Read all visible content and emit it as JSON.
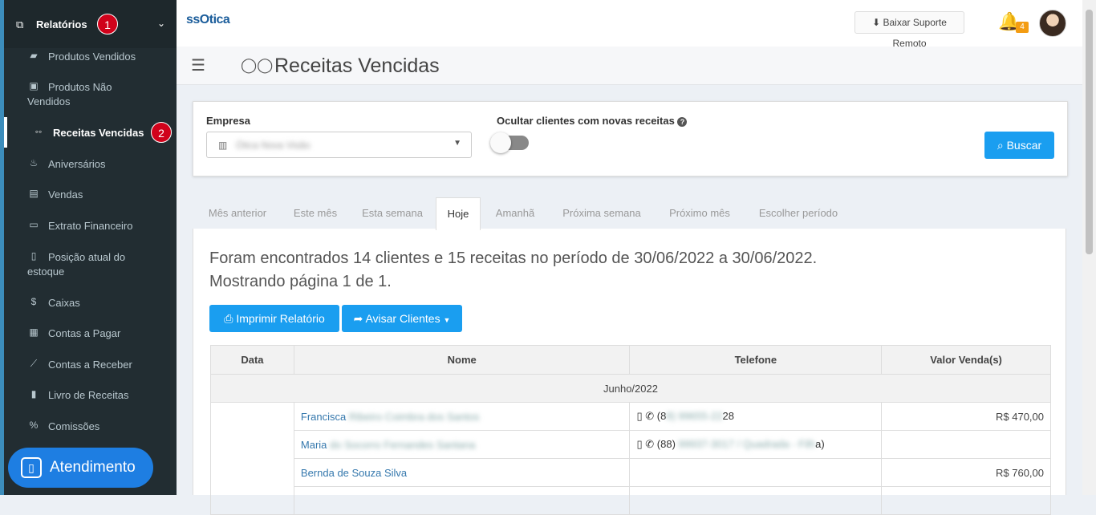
{
  "sidebar": {
    "header": {
      "label": "Relatórios",
      "badge": "1"
    },
    "items": [
      {
        "label": "Produtos Vendidos",
        "icon": "bag-icon",
        "glyph": "▰"
      },
      {
        "label": "Produtos Não Vendidos",
        "icon": "calendar-icon",
        "glyph": "▣"
      },
      {
        "label": "Receitas Vencidas",
        "icon": "glasses-icon",
        "glyph": "◦◦",
        "badge": "2"
      },
      {
        "label": "Aniversários",
        "icon": "cake-icon",
        "glyph": "♨"
      },
      {
        "label": "Vendas",
        "icon": "basket-icon",
        "glyph": "▤"
      },
      {
        "label": "Extrato Financeiro",
        "icon": "money-icon",
        "glyph": "▭"
      },
      {
        "label": "Posição atual do estoque",
        "icon": "file-icon",
        "glyph": "▯"
      },
      {
        "label": "Caixas",
        "icon": "dollar-icon",
        "glyph": "$"
      },
      {
        "label": "Contas a Pagar",
        "icon": "calculator-icon",
        "glyph": "▦"
      },
      {
        "label": "Contas a Receber",
        "icon": "chart-line-icon",
        "glyph": "⟋"
      },
      {
        "label": "Livro de Receitas",
        "icon": "book-icon",
        "glyph": "▮"
      },
      {
        "label": "Comissões",
        "icon": "percent-icon",
        "glyph": "%"
      }
    ],
    "atendimento": "Atendimento"
  },
  "topbar": {
    "logo": "ssOtica",
    "suporte": "⬇ Baixar Suporte Remoto",
    "notifications": "4"
  },
  "header": {
    "title": "Receitas Vencidas"
  },
  "filter": {
    "empresa_label": "Empresa",
    "empresa_value": "Ótica Nova Visão",
    "ocultar_label": "Ocultar clientes com novas receitas",
    "buscar": "Buscar"
  },
  "tabs": [
    "Mês anterior",
    "Este mês",
    "Esta semana",
    "Hoje",
    "Amanhã",
    "Próxima semana",
    "Próximo mês",
    "Escolher período"
  ],
  "summary": {
    "line1": "Foram encontrados 14 clientes e 15 receitas no período de 30/06/2022 a 30/06/2022.",
    "line2": "Mostrando página 1 de 1."
  },
  "actions": {
    "imprimir": "Imprimir Relatório",
    "avisar": "Avisar Clientes"
  },
  "table": {
    "columns": [
      "Data",
      "Nome",
      "Telefone",
      "Valor Venda(s)"
    ],
    "group": "Junho/2022",
    "rows": [
      {
        "first": "Francisca",
        "last": "Ribeiro Coimbra dos Santos",
        "phone_a": "(8",
        "phone_mid": "8) 99655-22",
        "phone_b": "28",
        "value": "R$ 470,00"
      },
      {
        "first": "Maria",
        "last": "do Socorro Fernandes Santana",
        "phone_a": "(88)",
        "phone_mid": "99937-3017 / Quadrada - Filh",
        "phone_b": "a)",
        "value": ""
      },
      {
        "first": "Bernda de Souza Silva",
        "last": "",
        "phone_a": "",
        "phone_mid": "",
        "phone_b": "",
        "value": "R$ 760,00"
      }
    ]
  }
}
